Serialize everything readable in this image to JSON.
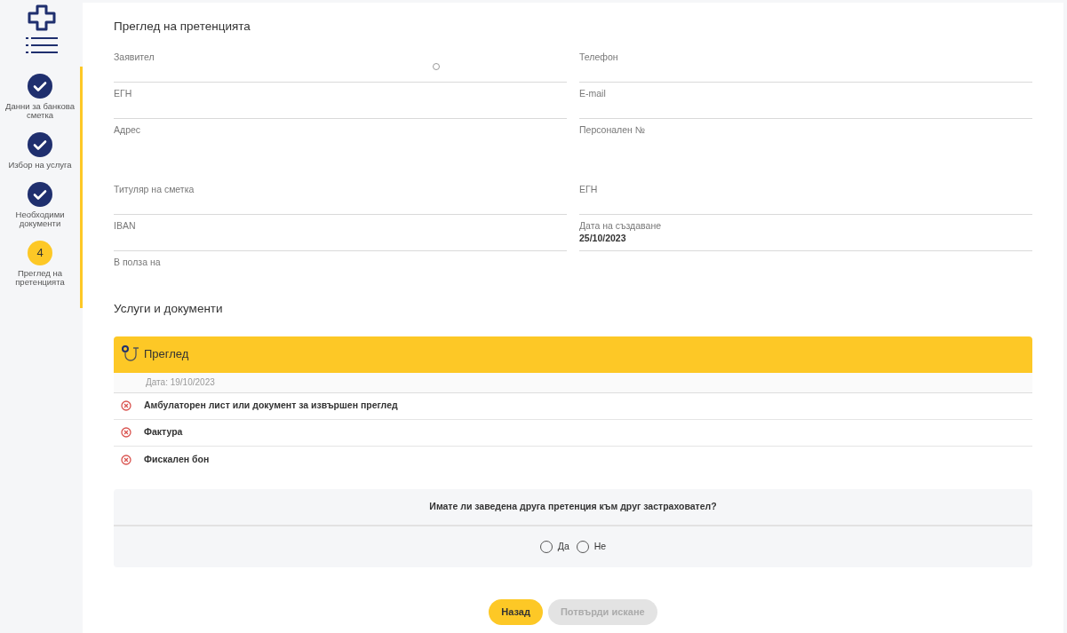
{
  "sidebar": {
    "steps": [
      {
        "label": "Данни за банкова сметка",
        "done": true
      },
      {
        "label": "Избор на услуга",
        "done": true
      },
      {
        "label": "Необходими документи",
        "done": true
      },
      {
        "label": "Преглед на претенцията",
        "done": false,
        "number": "4"
      }
    ]
  },
  "review": {
    "title": "Преглед на претенцията",
    "rows": [
      {
        "tall": false,
        "underline": true,
        "left": {
          "label": "Заявител",
          "loading": true
        },
        "right": {
          "label": "Телефон"
        }
      },
      {
        "tall": false,
        "underline": true,
        "left": {
          "label": "ЕГН"
        },
        "right": {
          "label": "E-mail"
        }
      },
      {
        "tall": true,
        "underline": false,
        "left": {
          "label": "Адрес"
        },
        "right": {
          "label": "Персонален №"
        }
      },
      {
        "tall": false,
        "underline": true,
        "left": {
          "label": "Титуляр на сметка"
        },
        "right": {
          "label": "ЕГН"
        }
      },
      {
        "tall": false,
        "underline": true,
        "left": {
          "label": "IBAN"
        },
        "right": {
          "label": "Дата на създаване",
          "value": "25/10/2023"
        }
      },
      {
        "tall": false,
        "underline": false,
        "left": {
          "label": "В полза на"
        }
      }
    ]
  },
  "services": {
    "title": "Услуги и документи",
    "groups": [
      {
        "name": "Преглед",
        "date": "Дата: 19/10/2023",
        "documents": [
          {
            "name": "Амбулаторен лист или документ за извършен преглед",
            "missing": true
          },
          {
            "name": "Фактура",
            "missing": true
          },
          {
            "name": "Фискален бон",
            "missing": true
          }
        ]
      }
    ]
  },
  "question": {
    "text": "Имате ли заведена друга претенция към друг застраховател?",
    "options": [
      {
        "label": "Да",
        "selected": false
      },
      {
        "label": "Не",
        "selected": false
      }
    ]
  },
  "buttons": [
    {
      "label": "Назад",
      "disabled": false
    },
    {
      "label": "Потвърди искане",
      "disabled": true
    }
  ]
}
